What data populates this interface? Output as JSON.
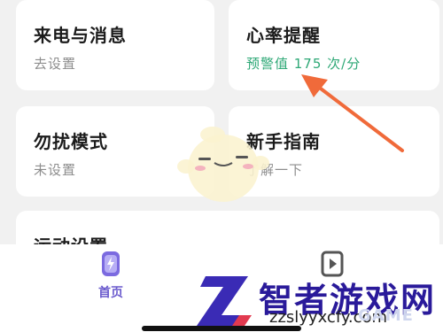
{
  "cards": {
    "call": {
      "title": "来电与消息",
      "sub": "去设置"
    },
    "heart": {
      "title": "心率提醒",
      "sub": "预警值 175 次/分"
    },
    "dnd": {
      "title": "勿扰模式",
      "sub": "未设置"
    },
    "guide": {
      "title": "新手指南",
      "sub": "了解一下"
    },
    "sport": {
      "title": "运动设置"
    }
  },
  "tabs": [
    {
      "label": "首页",
      "icon": "watch-icon"
    },
    {
      "label": "",
      "icon": "video-icon"
    }
  ],
  "watermark": {
    "name": "智者游戏网",
    "url": "zzslyyxcfy.com",
    "game": "GAME"
  },
  "colors": {
    "accent_green": "#2ea876",
    "tab_purple": "#6a5acd",
    "arrow": "#f06a3a"
  }
}
